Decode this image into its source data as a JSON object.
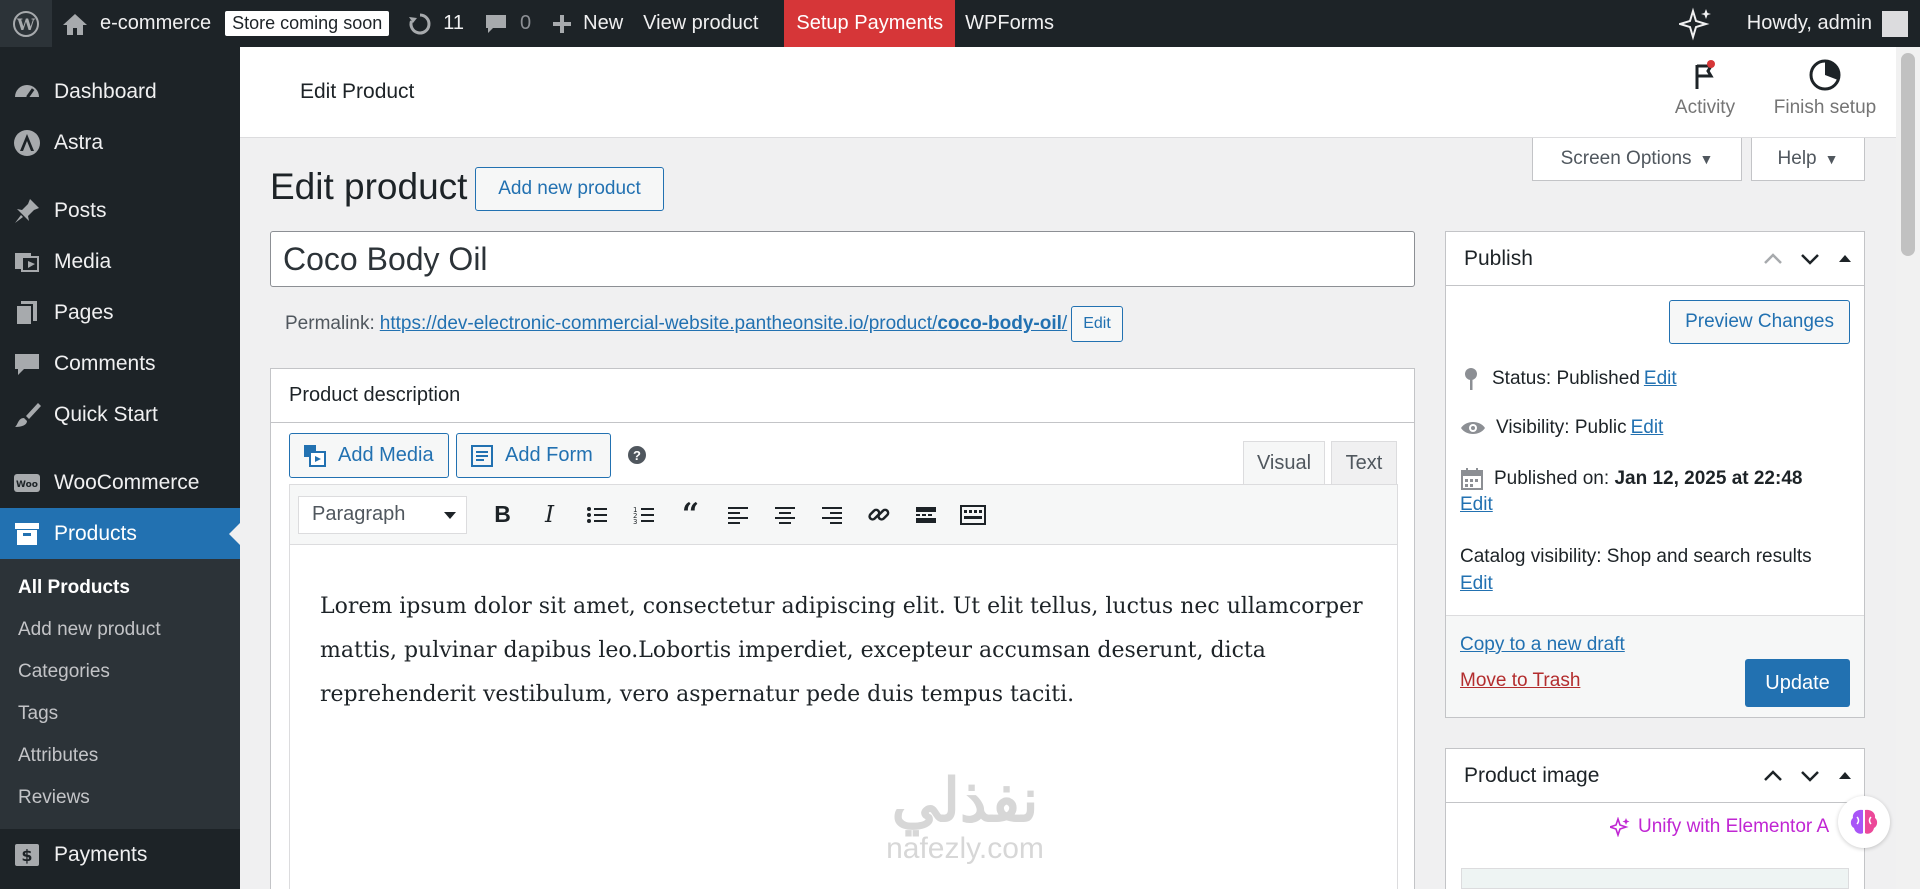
{
  "admin_bar": {
    "site_name": "e-commerce",
    "store_badge": "Store coming soon",
    "updates_count": "11",
    "comments_count": "0",
    "new_label": "New",
    "view_product": "View product",
    "setup_payments": "Setup Payments",
    "wpforms": "WPForms",
    "howdy": "Howdy, admin"
  },
  "sidebar": {
    "items": [
      {
        "label": "Dashboard",
        "icon": "dashboard-icon"
      },
      {
        "label": "Astra",
        "icon": "astra-icon"
      },
      {
        "label": "Posts",
        "icon": "pin-icon"
      },
      {
        "label": "Media",
        "icon": "media-icon"
      },
      {
        "label": "Pages",
        "icon": "page-icon"
      },
      {
        "label": "Comments",
        "icon": "comment-icon"
      },
      {
        "label": "Quick Start",
        "icon": "brush-icon"
      },
      {
        "label": "WooCommerce",
        "icon": "woo-icon"
      },
      {
        "label": "Products",
        "icon": "archive-icon"
      },
      {
        "label": "Payments",
        "icon": "dollar-icon"
      }
    ],
    "submenu": [
      "All Products",
      "Add new product",
      "Categories",
      "Tags",
      "Attributes",
      "Reviews"
    ]
  },
  "header": {
    "title": "Edit Product",
    "activity": "Activity",
    "finish_setup": "Finish setup"
  },
  "screen_options": "Screen Options",
  "help": "Help",
  "page": {
    "title": "Edit product",
    "add_new": "Add new product",
    "product_title": "Coco Body Oil",
    "permalink_label": "Permalink:",
    "permalink_base": "https://dev-electronic-commercial-website.pantheonsite.io/product/",
    "permalink_slug": "coco-body-oil",
    "permalink_end": "/",
    "permalink_edit": "Edit"
  },
  "description": {
    "heading": "Product description",
    "add_media": "Add Media",
    "add_form": "Add Form",
    "help_glyph": "?",
    "tab_visual": "Visual",
    "tab_text": "Text",
    "format": "Paragraph",
    "content": "Lorem ipsum dolor sit amet, consectetur adipiscing elit. Ut elit tellus, luctus nec ullamcorper mattis, pulvinar dapibus leo.Lobortis imperdiet, excepteur accumsan deserunt, dicta reprehenderit vestibulum, vero aspernatur pede duis tempus taciti."
  },
  "publish": {
    "heading": "Publish",
    "preview": "Preview Changes",
    "status_label": "Status:",
    "status_value": "Published",
    "visibility_label": "Visibility:",
    "visibility_value": "Public",
    "published_label": "Published on:",
    "published_value": "Jan 12, 2025 at 22:48",
    "catalog_label": "Catalog visibility:",
    "catalog_value": "Shop and search results",
    "edit": "Edit",
    "copy_draft": "Copy to a new draft",
    "trash": "Move to Trash",
    "update": "Update"
  },
  "product_image": {
    "heading": "Product image",
    "elementor": "Unify with Elementor A"
  },
  "watermark": {
    "arabic": "نفذلي",
    "latin": "nafezly.com"
  },
  "colors": {
    "admin_dark": "#1d2327",
    "accent": "#2271b1",
    "setup_red": "#d63638",
    "elementor": "#c026d3"
  }
}
